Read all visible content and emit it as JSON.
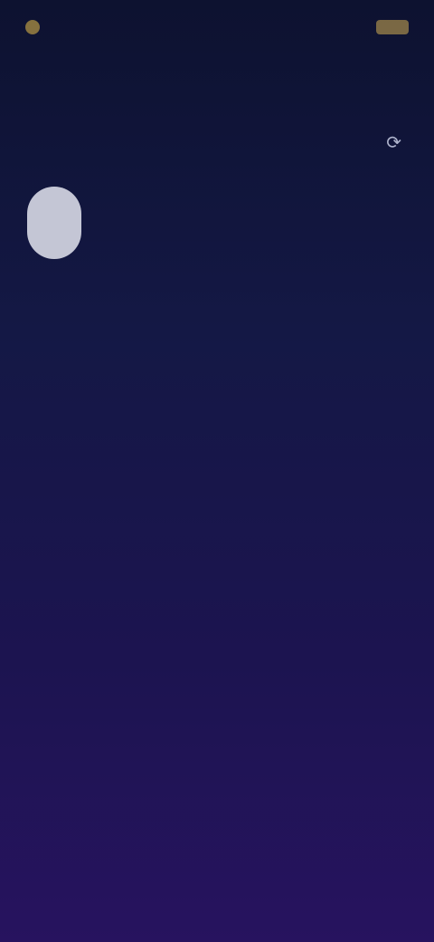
{
  "status_bar": {
    "time": "",
    "battery": ""
  },
  "header": {
    "back_label": "",
    "title": ""
  },
  "location": {
    "name": ""
  },
  "current": {
    "temperature": "",
    "unit": "",
    "icon": "weather-icon",
    "details": [
      {
        "label": "",
        "value": ""
      },
      {
        "label": "",
        "value": ""
      },
      {
        "label": "",
        "value": ""
      }
    ]
  },
  "forecast": [
    {
      "label": "",
      "value": ""
    },
    {
      "label": "",
      "value": ""
    }
  ],
  "colors": {
    "background_top": "#0d1230",
    "background_bottom": "#27135f",
    "status_accent": "#b99a45",
    "text_primary": "#d6d8e6",
    "text_secondary": "#9ea4c2"
  }
}
